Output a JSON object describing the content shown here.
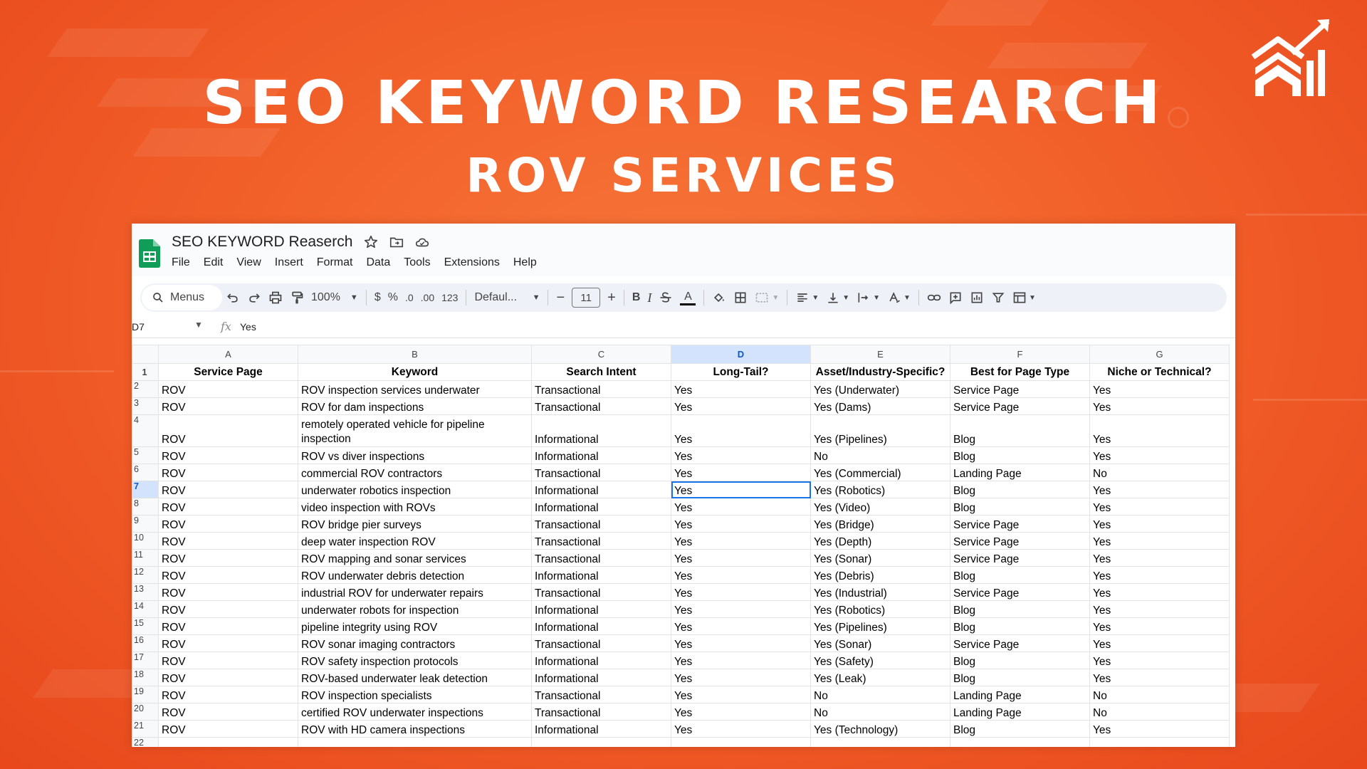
{
  "banner": {
    "title": "SEO KEYWORD RESEARCH",
    "subtitle": "ROV SERVICES",
    "accent_color": "#f2612a"
  },
  "app": {
    "doc_title": "SEO KEYWORD Reaserch",
    "title_icons": [
      "star-icon",
      "move-to-folder-icon",
      "cloud-status-icon"
    ],
    "menu": [
      "File",
      "Edit",
      "View",
      "Insert",
      "Format",
      "Data",
      "Tools",
      "Extensions",
      "Help"
    ]
  },
  "toolbar": {
    "search_label": "Menus",
    "zoom": "100%",
    "currency": "$",
    "percent": "%",
    "decrease_decimal": ".0",
    "increase_decimal": ".00",
    "number_format": "123",
    "font": "Defaul...",
    "font_size": "11",
    "bold": "B",
    "italic": "I",
    "text_color": "A"
  },
  "formula_bar": {
    "cell_ref": "D7",
    "fx": "fx",
    "value": "Yes"
  },
  "sheet": {
    "columns": [
      "A",
      "B",
      "C",
      "D",
      "E",
      "F",
      "G"
    ],
    "selected_column": "D",
    "selected_row": "7",
    "headers": [
      "Service Page",
      "Keyword",
      "Search Intent",
      "Long-Tail?",
      "Asset/Industry-Specific?",
      "Best for Page Type",
      "Niche or Technical?"
    ],
    "rows": [
      [
        "ROV",
        "ROV inspection services underwater",
        "Transactional",
        "Yes",
        "Yes (Underwater)",
        "Service Page",
        "Yes"
      ],
      [
        "ROV",
        "ROV for dam inspections",
        "Transactional",
        "Yes",
        "Yes (Dams)",
        "Service Page",
        "Yes"
      ],
      [
        "ROV",
        "remotely operated vehicle for pipeline inspection",
        "Informational",
        "Yes",
        "Yes (Pipelines)",
        "Blog",
        "Yes"
      ],
      [
        "ROV",
        "ROV vs diver inspections",
        "Informational",
        "Yes",
        "No",
        "Blog",
        "Yes"
      ],
      [
        "ROV",
        "commercial ROV contractors",
        "Transactional",
        "Yes",
        "Yes (Commercial)",
        "Landing Page",
        "No"
      ],
      [
        "ROV",
        "underwater robotics inspection",
        "Informational",
        "Yes",
        "Yes (Robotics)",
        "Blog",
        "Yes"
      ],
      [
        "ROV",
        "video inspection with ROVs",
        "Informational",
        "Yes",
        "Yes (Video)",
        "Blog",
        "Yes"
      ],
      [
        "ROV",
        "ROV bridge pier surveys",
        "Transactional",
        "Yes",
        "Yes (Bridge)",
        "Service Page",
        "Yes"
      ],
      [
        "ROV",
        "deep water inspection ROV",
        "Transactional",
        "Yes",
        "Yes (Depth)",
        "Service Page",
        "Yes"
      ],
      [
        "ROV",
        "ROV mapping and sonar services",
        "Transactional",
        "Yes",
        "Yes (Sonar)",
        "Service Page",
        "Yes"
      ],
      [
        "ROV",
        "ROV underwater debris detection",
        "Informational",
        "Yes",
        "Yes (Debris)",
        "Blog",
        "Yes"
      ],
      [
        "ROV",
        "industrial ROV for underwater repairs",
        "Transactional",
        "Yes",
        "Yes (Industrial)",
        "Service Page",
        "Yes"
      ],
      [
        "ROV",
        "underwater robots for inspection",
        "Informational",
        "Yes",
        "Yes (Robotics)",
        "Blog",
        "Yes"
      ],
      [
        "ROV",
        "pipeline integrity using ROV",
        "Informational",
        "Yes",
        "Yes (Pipelines)",
        "Blog",
        "Yes"
      ],
      [
        "ROV",
        "ROV sonar imaging contractors",
        "Transactional",
        "Yes",
        "Yes (Sonar)",
        "Service Page",
        "Yes"
      ],
      [
        "ROV",
        "ROV safety inspection protocols",
        "Informational",
        "Yes",
        "Yes (Safety)",
        "Blog",
        "Yes"
      ],
      [
        "ROV",
        "ROV-based underwater leak detection",
        "Informational",
        "Yes",
        "Yes (Leak)",
        "Blog",
        "Yes"
      ],
      [
        "ROV",
        "ROV inspection specialists",
        "Transactional",
        "Yes",
        "No",
        "Landing Page",
        "No"
      ],
      [
        "ROV",
        "certified ROV underwater inspections",
        "Transactional",
        "Yes",
        "No",
        "Landing Page",
        "No"
      ],
      [
        "ROV",
        "ROV with HD camera inspections",
        "Informational",
        "Yes",
        "Yes (Technology)",
        "Blog",
        "Yes"
      ]
    ],
    "row_numbers": [
      "1",
      "2",
      "3",
      "4",
      "5",
      "6",
      "7",
      "8",
      "9",
      "10",
      "11",
      "12",
      "13",
      "14",
      "15",
      "16",
      "17",
      "18",
      "19",
      "20",
      "21",
      "22"
    ]
  }
}
